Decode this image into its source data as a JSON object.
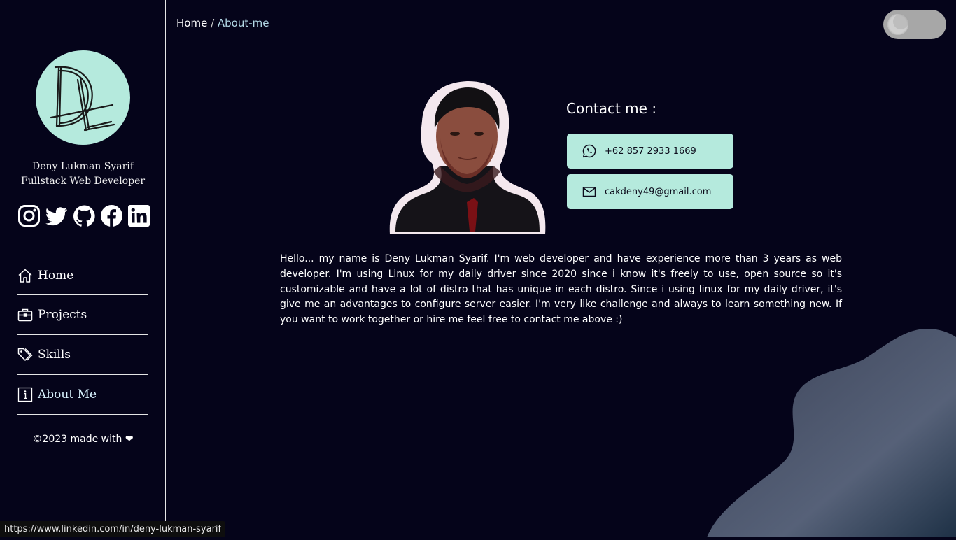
{
  "sidebar": {
    "logo_icon": "dl-monogram-logo",
    "profile_name": "Deny Lukman Syarif",
    "profile_role": "Fullstack Web Developer",
    "socials": [
      {
        "icon": "instagram-icon"
      },
      {
        "icon": "twitter-icon"
      },
      {
        "icon": "github-icon"
      },
      {
        "icon": "facebook-icon"
      },
      {
        "icon": "linkedin-icon"
      }
    ],
    "nav": [
      {
        "label": "Home",
        "icon": "home-icon"
      },
      {
        "label": "Projects",
        "icon": "briefcase-icon"
      },
      {
        "label": "Skills",
        "icon": "tags-icon"
      },
      {
        "label": "About Me",
        "icon": "info-icon"
      }
    ],
    "footer": "©2023 made with ❤"
  },
  "header": {
    "breadcrumb_home": "Home",
    "breadcrumb_sep": " / ",
    "breadcrumb_current": "About-me",
    "theme_toggle_icon": "moon-icon"
  },
  "contact": {
    "title": "Contact me :",
    "phone": "+62 857 2933 1669",
    "email": "cakdeny49@gmail.com"
  },
  "bio": "Hello... my name is Deny Lukman Syarif. I'm web developer and have experience more than 3 years as web developer. I'm using Linux for my daily driver since 2020 since i know it's freely to use, open source so it's customizable and have a lot of distro that has unique in each distro. Since i using linux for my daily driver, it's give me an advantages to configure server easier. I'm very like challenge and always to learn something new. If you want to work together or hire me feel free to contact me above :)",
  "status_bar": "https://www.linkedin.com/in/deny-lukman-syarif",
  "colors": {
    "background": "#05041a",
    "accent": "#b5eadd",
    "text": "#ffffff"
  }
}
